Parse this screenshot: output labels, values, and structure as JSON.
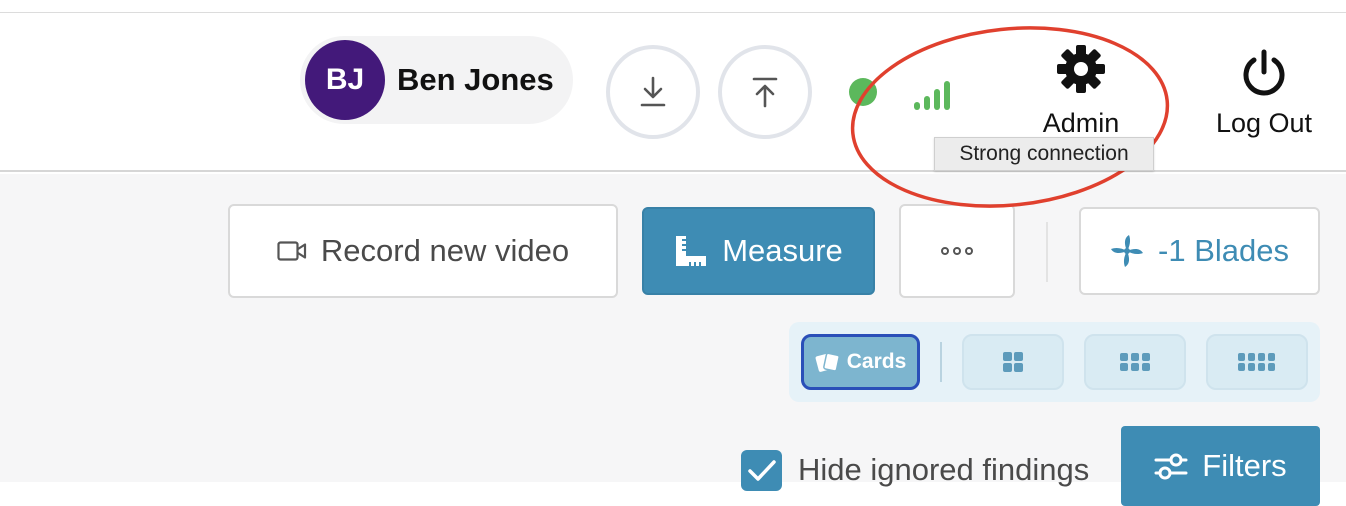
{
  "header": {
    "user": {
      "initials": "BJ",
      "name": "Ben Jones"
    },
    "download_icon": "download-icon",
    "upload_icon": "upload-icon",
    "status_icon": "status-dot-icon",
    "signal_icon": "signal-bars-icon",
    "admin_label": "Admin",
    "logout_label": "Log Out",
    "tooltip": "Strong connection"
  },
  "toolbar": {
    "record_label": "Record new video",
    "measure_label": "Measure",
    "more_label": "∘∘∘",
    "blades_label": "-1 Blades"
  },
  "view_modes": {
    "cards_label": "Cards",
    "options": [
      "Cards",
      "grid-2-icon",
      "grid-3-icon",
      "grid-4-icon"
    ]
  },
  "filters": {
    "hide_ignored_label": "Hide ignored findings",
    "hide_ignored_checked": true,
    "filters_label": "Filters"
  },
  "colors": {
    "accent": "#3e8cb4",
    "avatar": "#43197a",
    "status_green": "#5cb85c",
    "annotation_red": "#e0402e"
  }
}
